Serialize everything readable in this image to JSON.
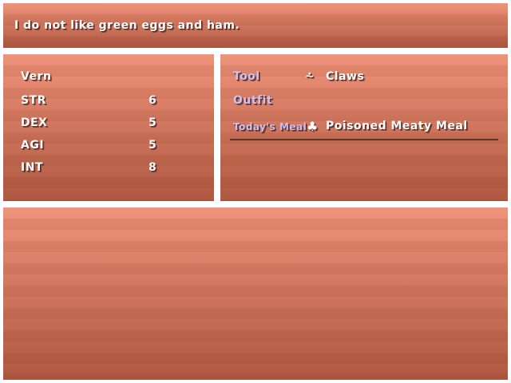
{
  "message": {
    "text": "I do not like green eggs and ham."
  },
  "character": {
    "name": "Vern",
    "stats": [
      {
        "name": "STR",
        "value": "6"
      },
      {
        "name": "DEX",
        "value": "5"
      },
      {
        "name": "AGI",
        "value": "5"
      },
      {
        "name": "INT",
        "value": "8"
      }
    ]
  },
  "equipment": {
    "tool": {
      "label": "Tool",
      "icon": "claw-icon",
      "icon_glyph": "⩪",
      "value": "Claws"
    },
    "outfit": {
      "label": "Outfit",
      "value": ""
    },
    "meal": {
      "label": "Today's Meal",
      "icon": "meat-icon",
      "icon_glyph": "♣",
      "value": "Poisoned Meaty Meal"
    }
  },
  "colors": {
    "panel_top": "#f0937a",
    "panel_bottom": "#8a3b22",
    "text": "#ffffff",
    "label_text": "#c9c2f3",
    "background": "#ffffff"
  }
}
